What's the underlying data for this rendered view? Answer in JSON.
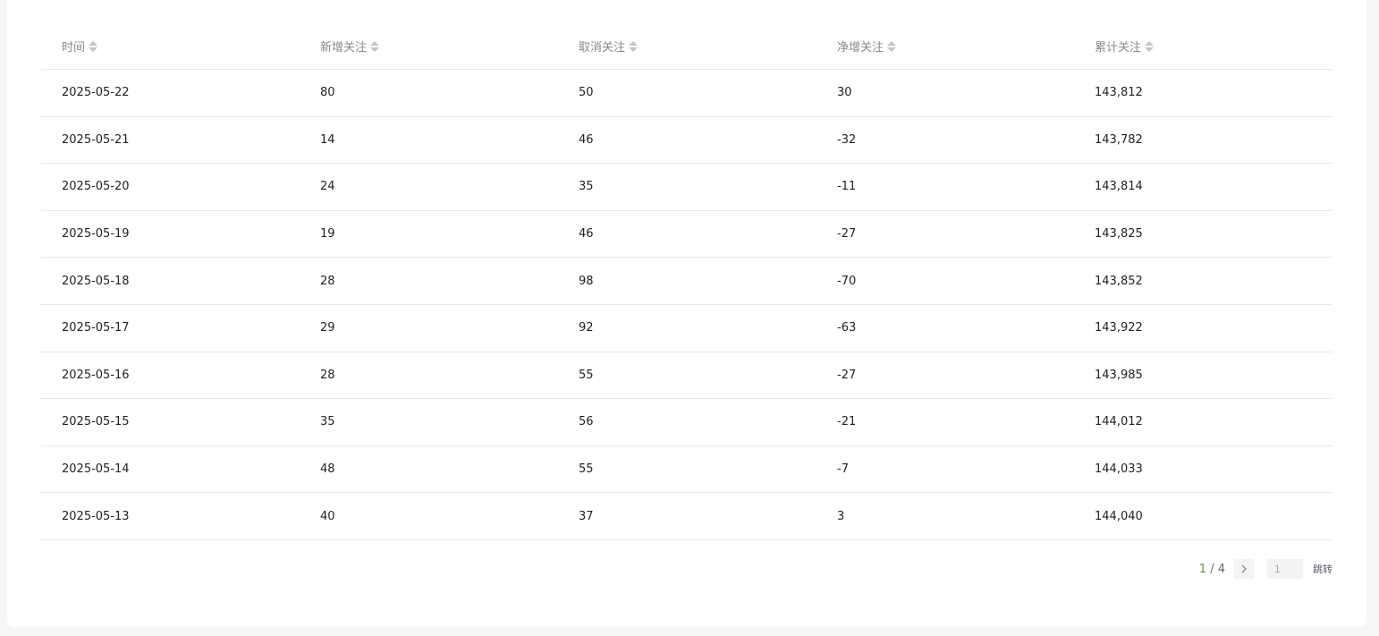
{
  "table": {
    "headers": [
      "时间",
      "新增关注",
      "取消关注",
      "净增关注",
      "累计关注"
    ],
    "rows": [
      [
        "2025-05-22",
        "80",
        "50",
        "30",
        "143,812"
      ],
      [
        "2025-05-21",
        "14",
        "46",
        "-32",
        "143,782"
      ],
      [
        "2025-05-20",
        "24",
        "35",
        "-11",
        "143,814"
      ],
      [
        "2025-05-19",
        "19",
        "46",
        "-27",
        "143,825"
      ],
      [
        "2025-05-18",
        "28",
        "98",
        "-70",
        "143,852"
      ],
      [
        "2025-05-17",
        "29",
        "92",
        "-63",
        "143,922"
      ],
      [
        "2025-05-16",
        "28",
        "55",
        "-27",
        "143,985"
      ],
      [
        "2025-05-15",
        "35",
        "56",
        "-21",
        "144,012"
      ],
      [
        "2025-05-14",
        "48",
        "55",
        "-7",
        "144,033"
      ],
      [
        "2025-05-13",
        "40",
        "37",
        "3",
        "144,040"
      ]
    ]
  },
  "pagination": {
    "current": "1",
    "separator": " / ",
    "total": "4",
    "next_icon": "chevron-right-icon",
    "jump_value": "1",
    "jump_label": "跳转"
  },
  "colors": {
    "current_page": "#6b8e4e",
    "border": "#e8e8e8"
  }
}
